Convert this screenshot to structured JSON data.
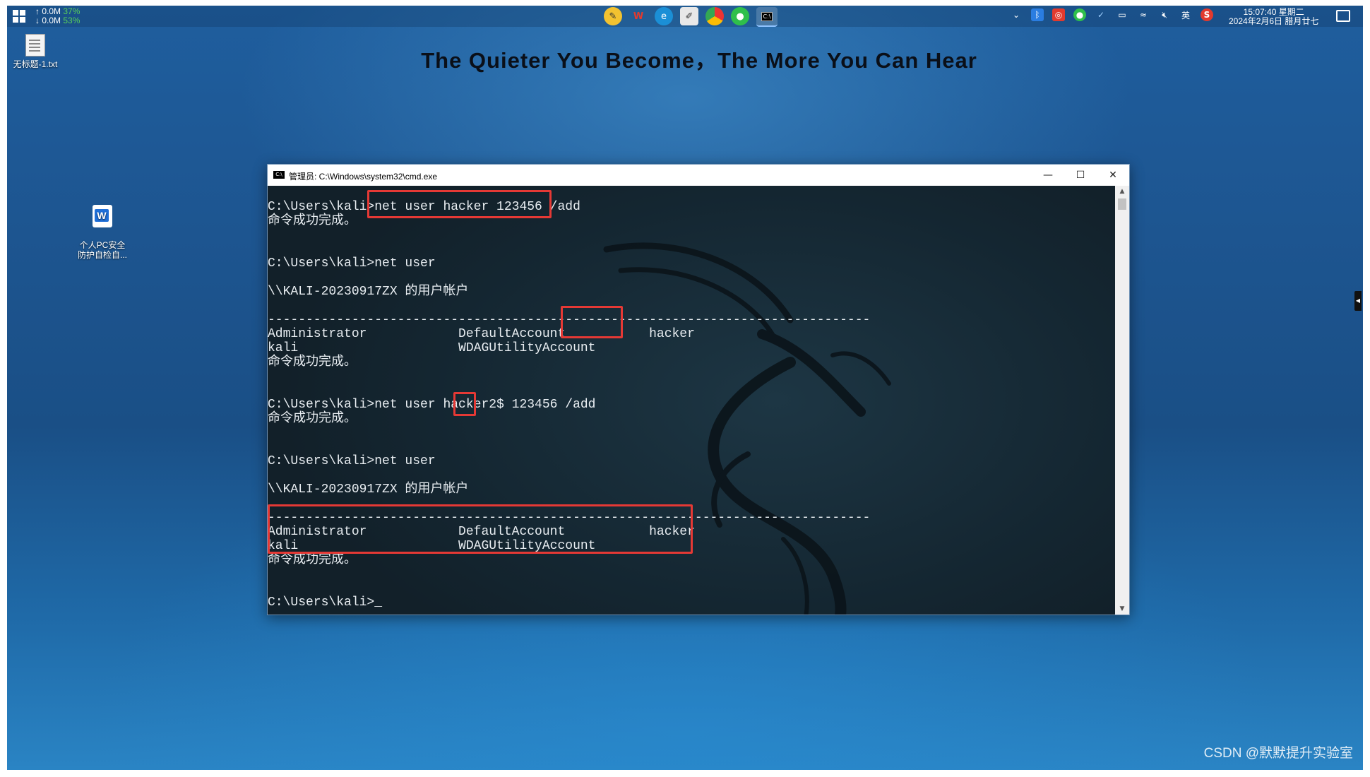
{
  "taskbar": {
    "net_up": "↑ 0.0M",
    "net_up_pct": "37%",
    "net_down": "↓ 0.0M",
    "net_down_pct": "53%",
    "pinned_apps": [
      "notes-app-icon",
      "wps-icon",
      "edge-icon",
      "editor-icon",
      "chrome-icon",
      "wechat-icon",
      "cmd-icon"
    ],
    "ime_label": "英",
    "clock_time": "15:07:40 星期二",
    "clock_date": "2024年2月6日 腊月廿七"
  },
  "desktop": {
    "headline": "The Quieter You Become，The More You Can Hear",
    "icons": [
      {
        "label": "无标题-1.txt"
      },
      {
        "label": "个人PC安全\n防护自检自..."
      }
    ]
  },
  "cmd_window": {
    "title": "管理员: C:\\Windows\\system32\\cmd.exe",
    "icon_text": "C:\\",
    "controls": {
      "minimize": "—",
      "maximize": "☐",
      "close": "✕"
    },
    "console_lines": [
      "C:\\Users\\kali>net user hacker 123456 /add",
      "命令成功完成。",
      "",
      "",
      "C:\\Users\\kali>net user",
      "",
      "\\\\KALI-20230917ZX 的用户帐户",
      "",
      "-------------------------------------------------------------------------------",
      "Administrator            DefaultAccount           hacker",
      "kali                     WDAGUtilityAccount",
      "命令成功完成。",
      "",
      "",
      "C:\\Users\\kali>net user hacker2$ 123456 /add",
      "命令成功完成。",
      "",
      "",
      "C:\\Users\\kali>net user",
      "",
      "\\\\KALI-20230917ZX 的用户帐户",
      "",
      "-------------------------------------------------------------------------------",
      "Administrator            DefaultAccount           hacker",
      "kali                     WDAGUtilityAccount",
      "命令成功完成。",
      "",
      "",
      "C:\\Users\\kali>_"
    ]
  },
  "watermark": "CSDN @默默提升实验室",
  "colors": {
    "highlight_box": "#e53935",
    "console_text": "#e9eef2",
    "net_pct": "#59d05a"
  }
}
